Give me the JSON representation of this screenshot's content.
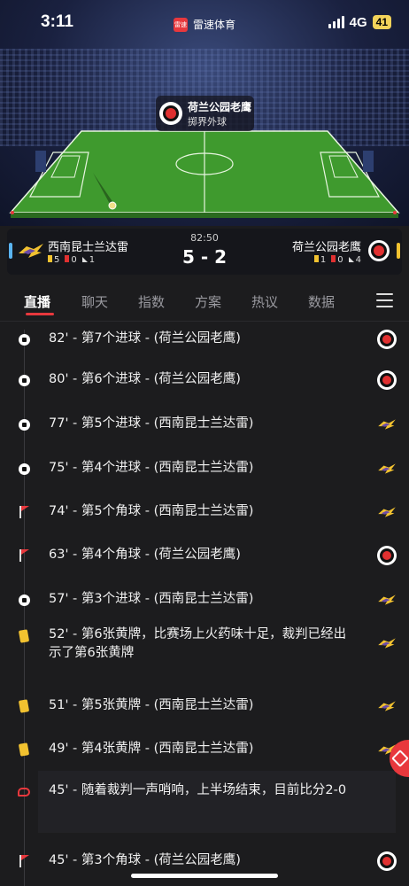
{
  "status": {
    "time": "3:11",
    "network": "4G",
    "battery": "41"
  },
  "brand": {
    "logo_text": "雷速",
    "name": "雷速体育"
  },
  "pitch_event": {
    "team": "荷兰公园老鹰",
    "event": "掷界外球"
  },
  "score": {
    "home": "西南昆士兰达雷",
    "away": "荷兰公园老鹰",
    "time": "82:50",
    "result": "5 - 2",
    "home_stats": {
      "yellow": "5",
      "red": "0",
      "corner": "1"
    },
    "away_stats": {
      "yellow": "1",
      "red": "0",
      "corner": "4"
    }
  },
  "tabs": [
    "直播",
    "聊天",
    "指数",
    "方案",
    "热议",
    "数据"
  ],
  "events": [
    {
      "icon": "ball",
      "text": "82' - 第7个进球 - (荷兰公园老鹰)",
      "team": "away"
    },
    {
      "icon": "ball",
      "text": "80' - 第6个进球 - (荷兰公园老鹰)",
      "team": "away"
    },
    {
      "icon": "ball",
      "text": "77' - 第5个进球 - (西南昆士兰达雷)",
      "team": "home"
    },
    {
      "icon": "ball",
      "text": "75' - 第4个进球 - (西南昆士兰达雷)",
      "team": "home"
    },
    {
      "icon": "corner",
      "text": "74' - 第5个角球 - (西南昆士兰达雷)",
      "team": "home"
    },
    {
      "icon": "corner",
      "text": "63' - 第4个角球 - (荷兰公园老鹰)",
      "team": "away"
    },
    {
      "icon": "ball",
      "text": "57' - 第3个进球 - (西南昆士兰达雷)",
      "team": "home"
    },
    {
      "icon": "yellow",
      "text": "52' - 第6张黄牌，比赛场上火药味十足，裁判已经出示了第6张黄牌",
      "team": "home"
    },
    {
      "icon": "yellow",
      "text": "51' - 第5张黄牌 - (西南昆士兰达雷)",
      "team": "home"
    },
    {
      "icon": "yellow",
      "text": "49' - 第4张黄牌 - (西南昆士兰达雷)",
      "team": "home"
    },
    {
      "icon": "whistle",
      "text": "45' - 随着裁判一声哨响，上半场结束，目前比分2-0",
      "team": ""
    },
    {
      "icon": "corner",
      "text": "45' - 第3个角球 - (荷兰公园老鹰)",
      "team": "away"
    }
  ],
  "colors": {
    "accent": "#e8383d",
    "yellow": "#f2c230",
    "pitch": "#3f9a2e"
  }
}
